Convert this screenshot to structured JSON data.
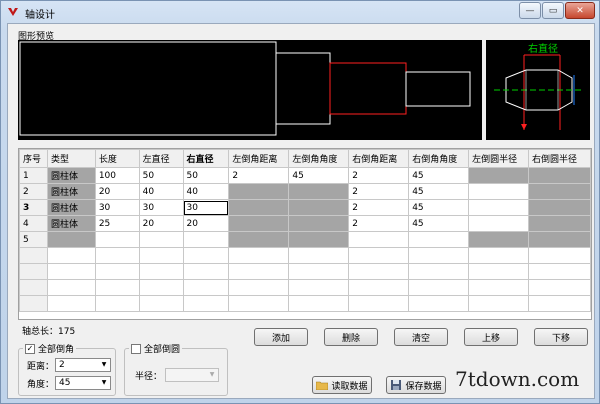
{
  "window": {
    "title": "轴设计",
    "controls": {
      "minimize": "—",
      "restore": "▭",
      "close": "✕"
    }
  },
  "preview": {
    "label": "图形预览",
    "side_label": "右直径"
  },
  "grid": {
    "headers": [
      "序号",
      "类型",
      "长度",
      "左直径",
      "右直径",
      "左倒角距离",
      "左倒角角度",
      "右倒角距离",
      "右倒角角度",
      "左倒圆半径",
      "右倒圆半径"
    ],
    "rows": [
      {
        "id": "1",
        "type": "圆柱体",
        "length": "100",
        "left_d": "50",
        "right_d": "50",
        "lc_dist": "2",
        "lc_angle": "45",
        "rc_dist": "2",
        "rc_angle": "45",
        "lr": "",
        "rr": ""
      },
      {
        "id": "2",
        "type": "圆柱体",
        "length": "20",
        "left_d": "40",
        "right_d": "40",
        "lc_dist": "",
        "lc_angle": "",
        "rc_dist": "2",
        "rc_angle": "45",
        "lr": "",
        "rr": ""
      },
      {
        "id": "3",
        "type": "圆柱体",
        "length": "30",
        "left_d": "30",
        "right_d": "30",
        "lc_dist": "",
        "lc_angle": "",
        "rc_dist": "2",
        "rc_angle": "45",
        "lr": "",
        "rr": ""
      },
      {
        "id": "4",
        "type": "圆柱体",
        "length": "25",
        "left_d": "20",
        "right_d": "20",
        "lc_dist": "",
        "lc_angle": "",
        "rc_dist": "2",
        "rc_angle": "45",
        "lr": "",
        "rr": ""
      },
      {
        "id": "5",
        "type": "",
        "length": "",
        "left_d": "",
        "right_d": "",
        "lc_dist": "",
        "lc_angle": "",
        "rc_dist": "",
        "rc_angle": "",
        "lr": "",
        "rr": ""
      }
    ]
  },
  "total": {
    "label": "轴总长：",
    "value": "175"
  },
  "buttons": {
    "add": "添加",
    "delete": "删除",
    "clear": "清空",
    "move_up": "上移",
    "move_down": "下移",
    "read": "读取数据",
    "save": "保存数据"
  },
  "chamfer": {
    "label": "全部倒角",
    "checked": "✓",
    "distance_label": "距离：",
    "distance_value": "2",
    "angle_label": "角度：",
    "angle_value": "45"
  },
  "fillet": {
    "label": "全部倒圆",
    "radius_label": "半径：",
    "radius_value": ""
  },
  "watermark": "7tdown.com",
  "colors": {
    "red_outline": "#ff2020",
    "green_label": "#00d000",
    "gray_cell": "#a5a5a5"
  }
}
